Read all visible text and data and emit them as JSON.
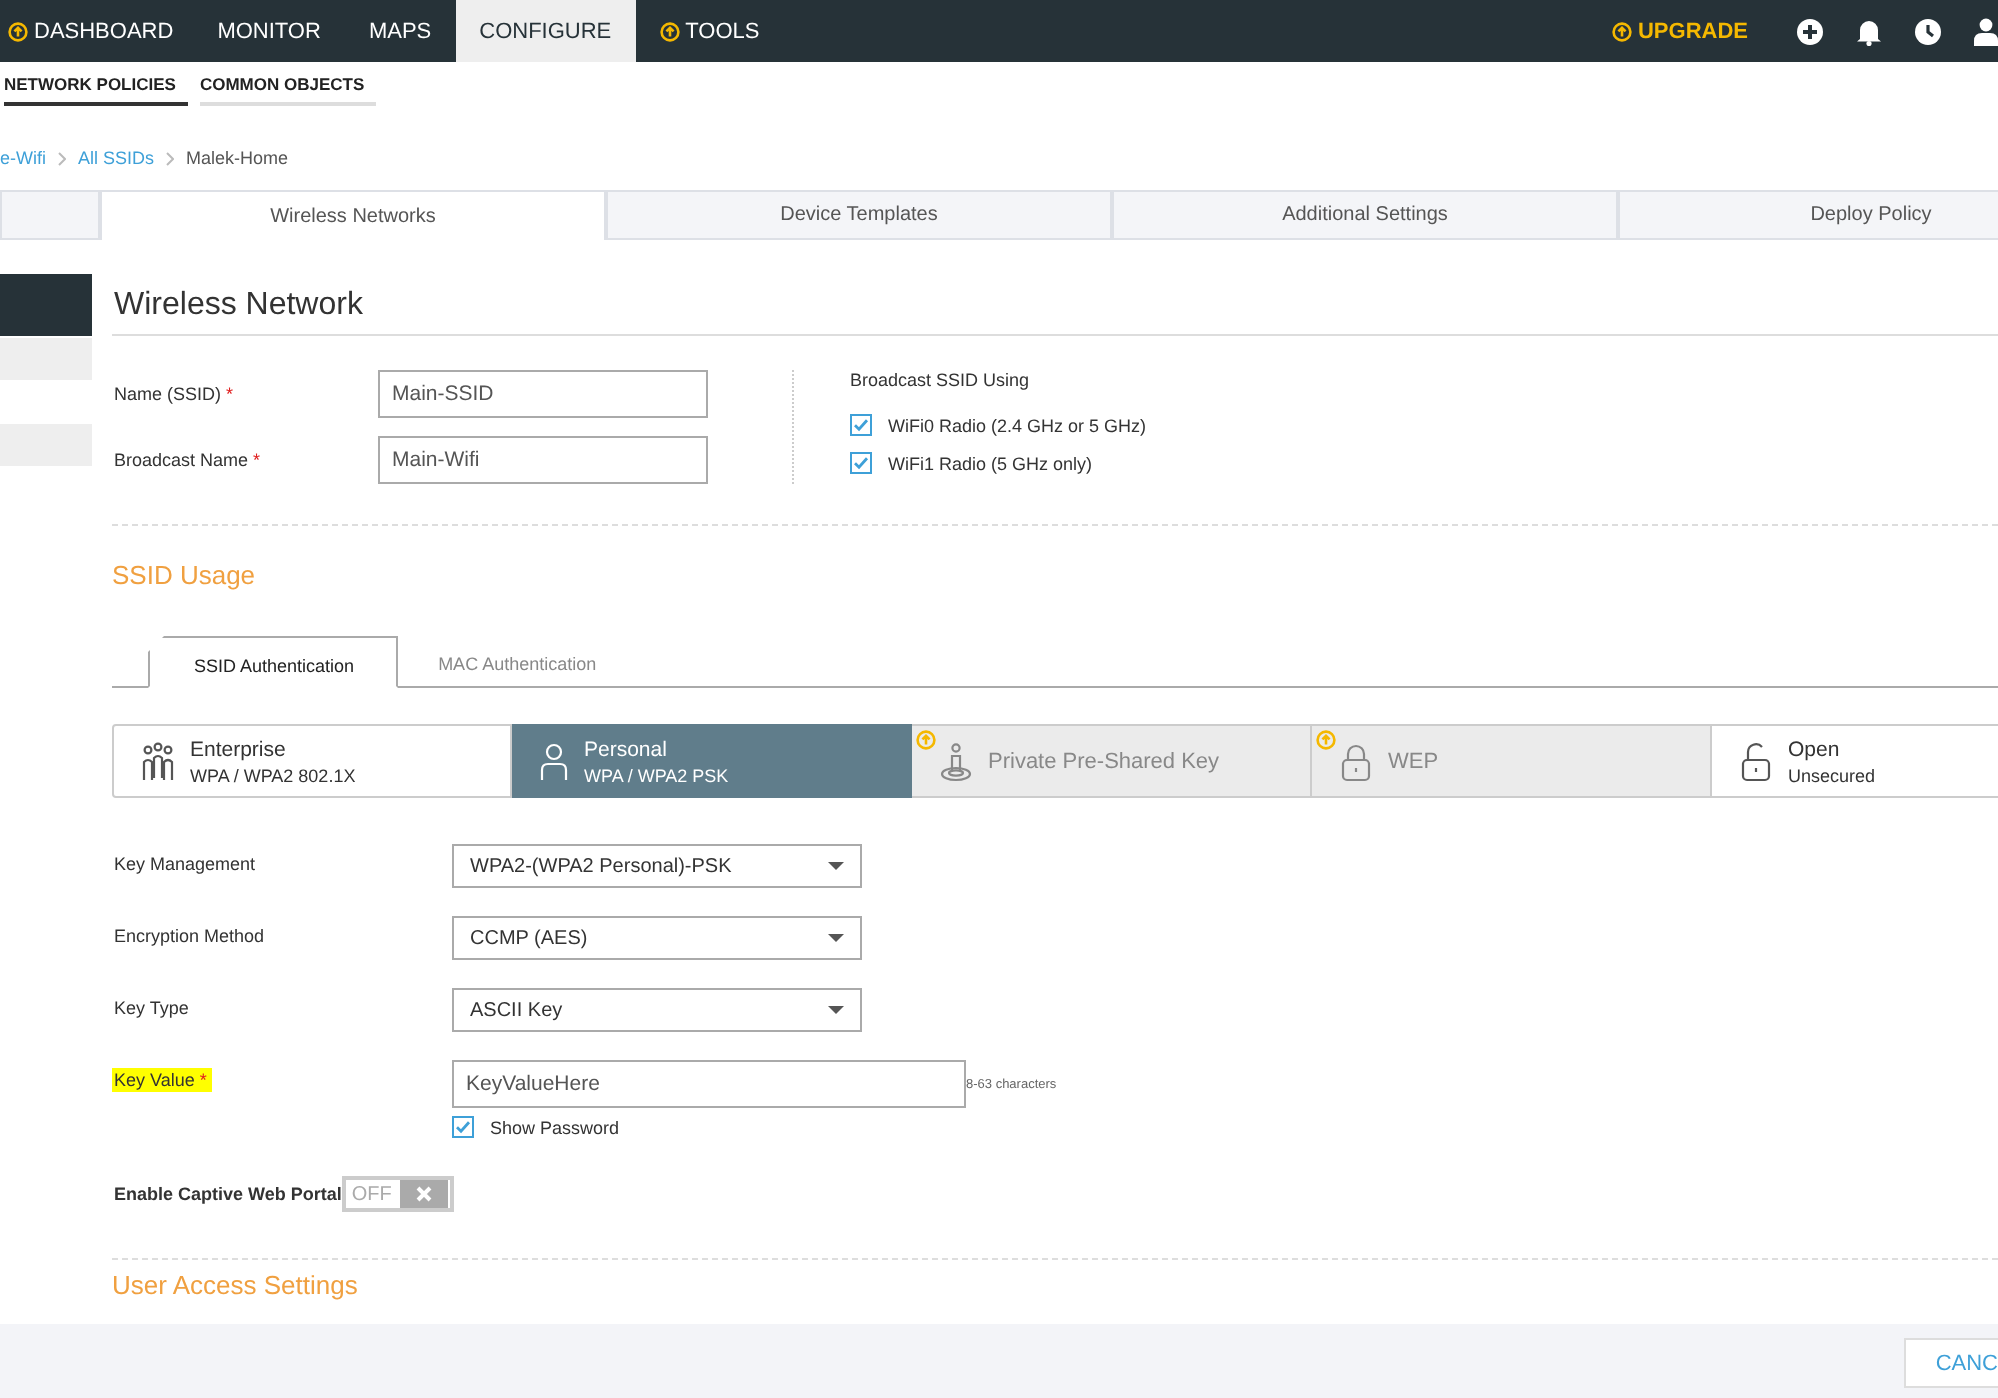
{
  "top_nav": {
    "items": [
      {
        "label": "DASHBOARD",
        "selected": false,
        "upgrade": true
      },
      {
        "label": "MONITOR",
        "selected": false,
        "upgrade": false
      },
      {
        "label": "MAPS",
        "selected": false,
        "upgrade": false
      },
      {
        "label": "CONFIGURE",
        "selected": true,
        "upgrade": false
      },
      {
        "label": "TOOLS",
        "selected": false,
        "upgrade": true
      }
    ],
    "upgrade_link": "UPGRADE"
  },
  "sub_nav": [
    {
      "label": "NETWORK POLICIES",
      "selected": true
    },
    {
      "label": "COMMON OBJECTS",
      "selected": false
    }
  ],
  "breadcrumb": [
    {
      "label": "e-Wifi",
      "link": true
    },
    {
      "label": "All SSIDs",
      "link": true
    },
    {
      "label": "Malek-Home",
      "link": false
    }
  ],
  "steps": [
    {
      "label": "Wireless Networks",
      "selected": true
    },
    {
      "label": "Device Templates",
      "selected": false
    },
    {
      "label": "Additional Settings",
      "selected": false
    },
    {
      "label": "Deploy Policy",
      "selected": false
    }
  ],
  "sidebar": {
    "items": [
      {
        "selected": true
      },
      {
        "selected": false
      },
      {
        "selected": false
      }
    ]
  },
  "wireless_network": {
    "title": "Wireless Network",
    "fields": [
      {
        "label": "Name (SSID)",
        "required_mark": "*",
        "value": "Main-SSID"
      },
      {
        "label": "Broadcast Name",
        "required_mark": "*",
        "value": "Main-Wifi"
      }
    ],
    "broadcast": {
      "title": "Broadcast SSID Using",
      "options": [
        {
          "label": "WiFi0 Radio (2.4 GHz or 5 GHz)",
          "checked": true
        },
        {
          "label": "WiFi1 Radio (5 GHz only)",
          "checked": true
        }
      ]
    }
  },
  "ssid_usage": {
    "title": "SSID Usage",
    "tabs": [
      {
        "label": "SSID Authentication",
        "selected": true
      },
      {
        "label": "MAC Authentication",
        "selected": false
      }
    ],
    "auth_types": [
      {
        "kind": "enterprise",
        "title": "Enterprise",
        "subtitle": "WPA / WPA2 802.1X",
        "selected": false,
        "disabled": false,
        "upgrade": false
      },
      {
        "kind": "personal",
        "title": "Personal",
        "subtitle": "WPA / WPA2 PSK",
        "selected": true,
        "disabled": false,
        "upgrade": false
      },
      {
        "kind": "ppsk",
        "title": "Private Pre-Shared Key",
        "selected": false,
        "disabled": true,
        "upgrade": true
      },
      {
        "kind": "wep",
        "title": "WEP",
        "selected": false,
        "disabled": true,
        "upgrade": true
      },
      {
        "kind": "open",
        "title": "Open",
        "subtitle": "Unsecured",
        "selected": false,
        "disabled": false,
        "upgrade": false
      }
    ],
    "settings": [
      {
        "kind": "select",
        "label": "Key Management",
        "value": "WPA2-(WPA2 Personal)-PSK"
      },
      {
        "kind": "select",
        "label": "Encryption Method",
        "value": "CCMP (AES)"
      },
      {
        "kind": "select",
        "label": "Key Type",
        "value": "ASCII Key"
      },
      {
        "kind": "input",
        "label": "Key Value",
        "required_mark": "*",
        "highlighted": true,
        "value": "KeyValueHere",
        "hint": "8-63 characters",
        "show_password": {
          "label": "Show Password",
          "checked": true
        }
      },
      {
        "kind": "toggle",
        "label": "Enable Captive Web Portal",
        "on": false,
        "state_label": "OFF"
      }
    ]
  },
  "user_access": {
    "title": "User Access Settings"
  },
  "footer": {
    "cancel": "CANC"
  }
}
